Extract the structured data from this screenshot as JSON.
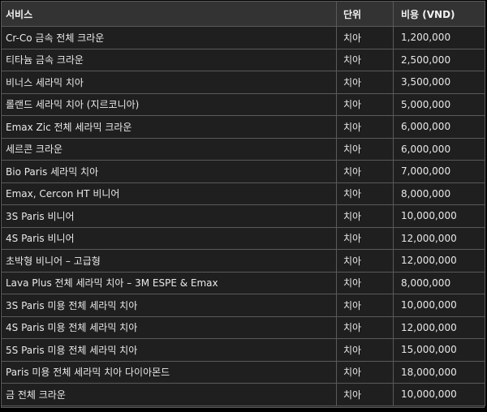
{
  "table": {
    "headers": {
      "service": "서비스",
      "unit": "단위",
      "cost": "비용 (VND)"
    },
    "rows": [
      {
        "service": "Cr-Co 금속 전체 크라운",
        "unit": "치아",
        "cost": "1,200,000"
      },
      {
        "service": "티타늄 금속 크라운",
        "unit": "치아",
        "cost": "2,500,000"
      },
      {
        "service": "비너스 세라믹 치아",
        "unit": "치아",
        "cost": "3,500,000"
      },
      {
        "service": "롤랜드 세라믹 치아 (지르코니아)",
        "unit": "치아",
        "cost": "5,000,000"
      },
      {
        "service": "Emax Zic 전체 세라믹 크라운",
        "unit": "치아",
        "cost": "6,000,000"
      },
      {
        "service": "세르콘 크라운",
        "unit": "치아",
        "cost": "6,000,000"
      },
      {
        "service": "Bio Paris 세라믹 치아",
        "unit": "치아",
        "cost": "7,000,000"
      },
      {
        "service": "Emax, Cercon HT 비니어",
        "unit": "치아",
        "cost": "8,000,000"
      },
      {
        "service": "3S Paris 비니어",
        "unit": "치아",
        "cost": "10,000,000"
      },
      {
        "service": "4S Paris 비니어",
        "unit": "치아",
        "cost": "12,000,000"
      },
      {
        "service": "초박형 비니어 – 고급형",
        "unit": "치아",
        "cost": "12,000,000"
      },
      {
        "service": "Lava Plus 전체 세라믹 치아 – 3M ESPE & Emax",
        "unit": "치아",
        "cost": "8,000,000"
      },
      {
        "service": "3S Paris 미용 전체 세라믹 치아",
        "unit": "치아",
        "cost": "10,000,000"
      },
      {
        "service": "4S Paris 미용 전체 세라믹 치아",
        "unit": "치아",
        "cost": "12,000,000"
      },
      {
        "service": "5S Paris 미용 전체 세라믹 치아",
        "unit": "치아",
        "cost": "15,000,000"
      },
      {
        "service": "Paris 미용 전체 세라믹 치아 다이아몬드",
        "unit": "치아",
        "cost": "18,000,000"
      },
      {
        "service": "금 전체 크라운",
        "unit": "치아",
        "cost": "10,000,000"
      }
    ]
  },
  "colors": {
    "background": "#000000",
    "header_bg": "#333333",
    "cell_bg": "#1f1f1f",
    "border": "#5a5a5a",
    "text": "#e8e8e8"
  }
}
